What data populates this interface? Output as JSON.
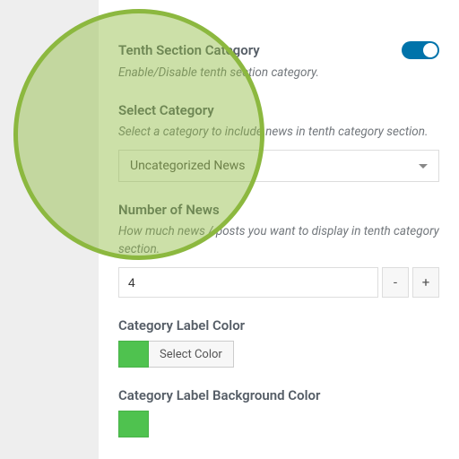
{
  "section1": {
    "title": "Tenth Section Category",
    "desc": "Enable/Disable tenth section category.",
    "toggle_on": true
  },
  "section2": {
    "title": "Select Category",
    "desc": "Select a category to include news in tenth category section.",
    "selected": "Uncategorized News"
  },
  "section3": {
    "title": "Number of News",
    "desc": "How much news / posts you want to display in tenth category section.",
    "value": "4",
    "minus": "-",
    "plus": "+"
  },
  "section4": {
    "title": "Category Label Color",
    "btn": "Select Color",
    "swatch": "#4fc24f"
  },
  "section5": {
    "title": "Category Label Background Color",
    "swatch": "#4fc24f"
  }
}
